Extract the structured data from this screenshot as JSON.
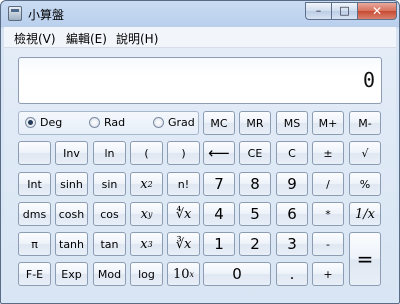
{
  "window": {
    "title": "小算盤",
    "min_glyph": "–",
    "max_glyph": "□",
    "close_glyph": "✕"
  },
  "menu": [
    {
      "label": "檢視(V)"
    },
    {
      "label": "編輯(E)"
    },
    {
      "label": "說明(H)"
    }
  ],
  "display": {
    "value": "0"
  },
  "angle_modes": [
    {
      "label": "Deg",
      "selected": true
    },
    {
      "label": "Rad",
      "selected": false
    },
    {
      "label": "Grad",
      "selected": false
    }
  ],
  "keys": {
    "mc": "MC",
    "mr": "MR",
    "ms": "MS",
    "mplus": "M+",
    "mminus": "M-",
    "inv": "Inv",
    "ln": "ln",
    "lparen": "(",
    "rparen": ")",
    "backspace": "⟵",
    "ce": "CE",
    "c": "C",
    "plusminus": "±",
    "sqrt": "√",
    "int": "Int",
    "sinh": "sinh",
    "sin": "sin",
    "x2_base": "x",
    "x2_exp": "2",
    "nfact": "n!",
    "d7": "7",
    "d8": "8",
    "d9": "9",
    "div": "/",
    "pct": "%",
    "dms": "dms",
    "cosh": "cosh",
    "cos": "cos",
    "xy_base": "x",
    "xy_exp": "y",
    "yroot": "∜x",
    "d4": "4",
    "d5": "5",
    "d6": "6",
    "mul": "*",
    "recip": "1/x",
    "pi": "π",
    "tanh": "tanh",
    "tan": "tan",
    "x3_base": "x",
    "x3_exp": "3",
    "cbrt": "∛x",
    "d1": "1",
    "d2": "2",
    "d3": "3",
    "sub": "-",
    "eq": "=",
    "fe": "F-E",
    "exp": "Exp",
    "mod": "Mod",
    "log": "log",
    "tenx_base": "10",
    "tenx_exp": "x",
    "d0": "0",
    "dot": ".",
    "add": "+"
  }
}
